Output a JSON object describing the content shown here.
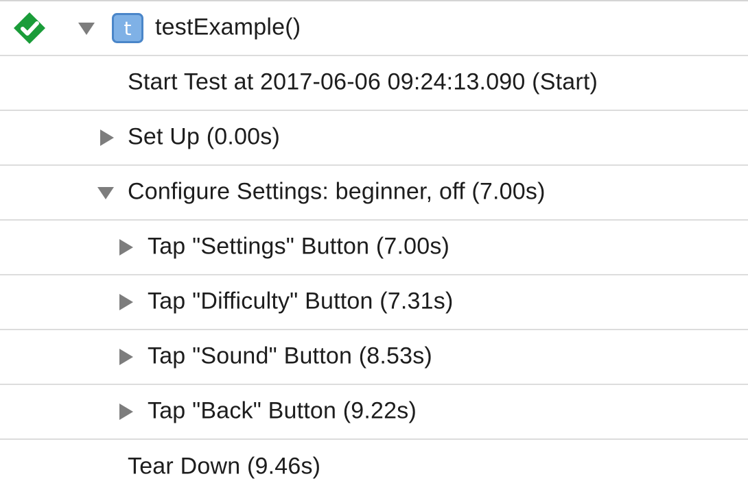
{
  "test": {
    "name": "testExample()",
    "status_icon": "green-checkmark-diamond-icon",
    "badge_icon": "test-method-icon",
    "badge_letter": "t",
    "colors": {
      "success": "#1a9c39",
      "badge_fill": "#7fb1e6",
      "badge_border": "#4a86c9",
      "disclosure": "#7d7d7d"
    }
  },
  "steps": [
    {
      "label": "Start Test at 2017-06-06 09:24:13.090 (Start)"
    },
    {
      "label": "Set Up (0.00s)"
    },
    {
      "label": "Configure Settings: beginner, off (7.00s)"
    },
    {
      "label": "Tap \"Settings\" Button (7.00s)"
    },
    {
      "label": "Tap \"Difficulty\" Button (7.31s)"
    },
    {
      "label": "Tap \"Sound\" Button (8.53s)"
    },
    {
      "label": "Tap \"Back\" Button (9.22s)"
    },
    {
      "label": "Tear Down (9.46s)"
    }
  ]
}
